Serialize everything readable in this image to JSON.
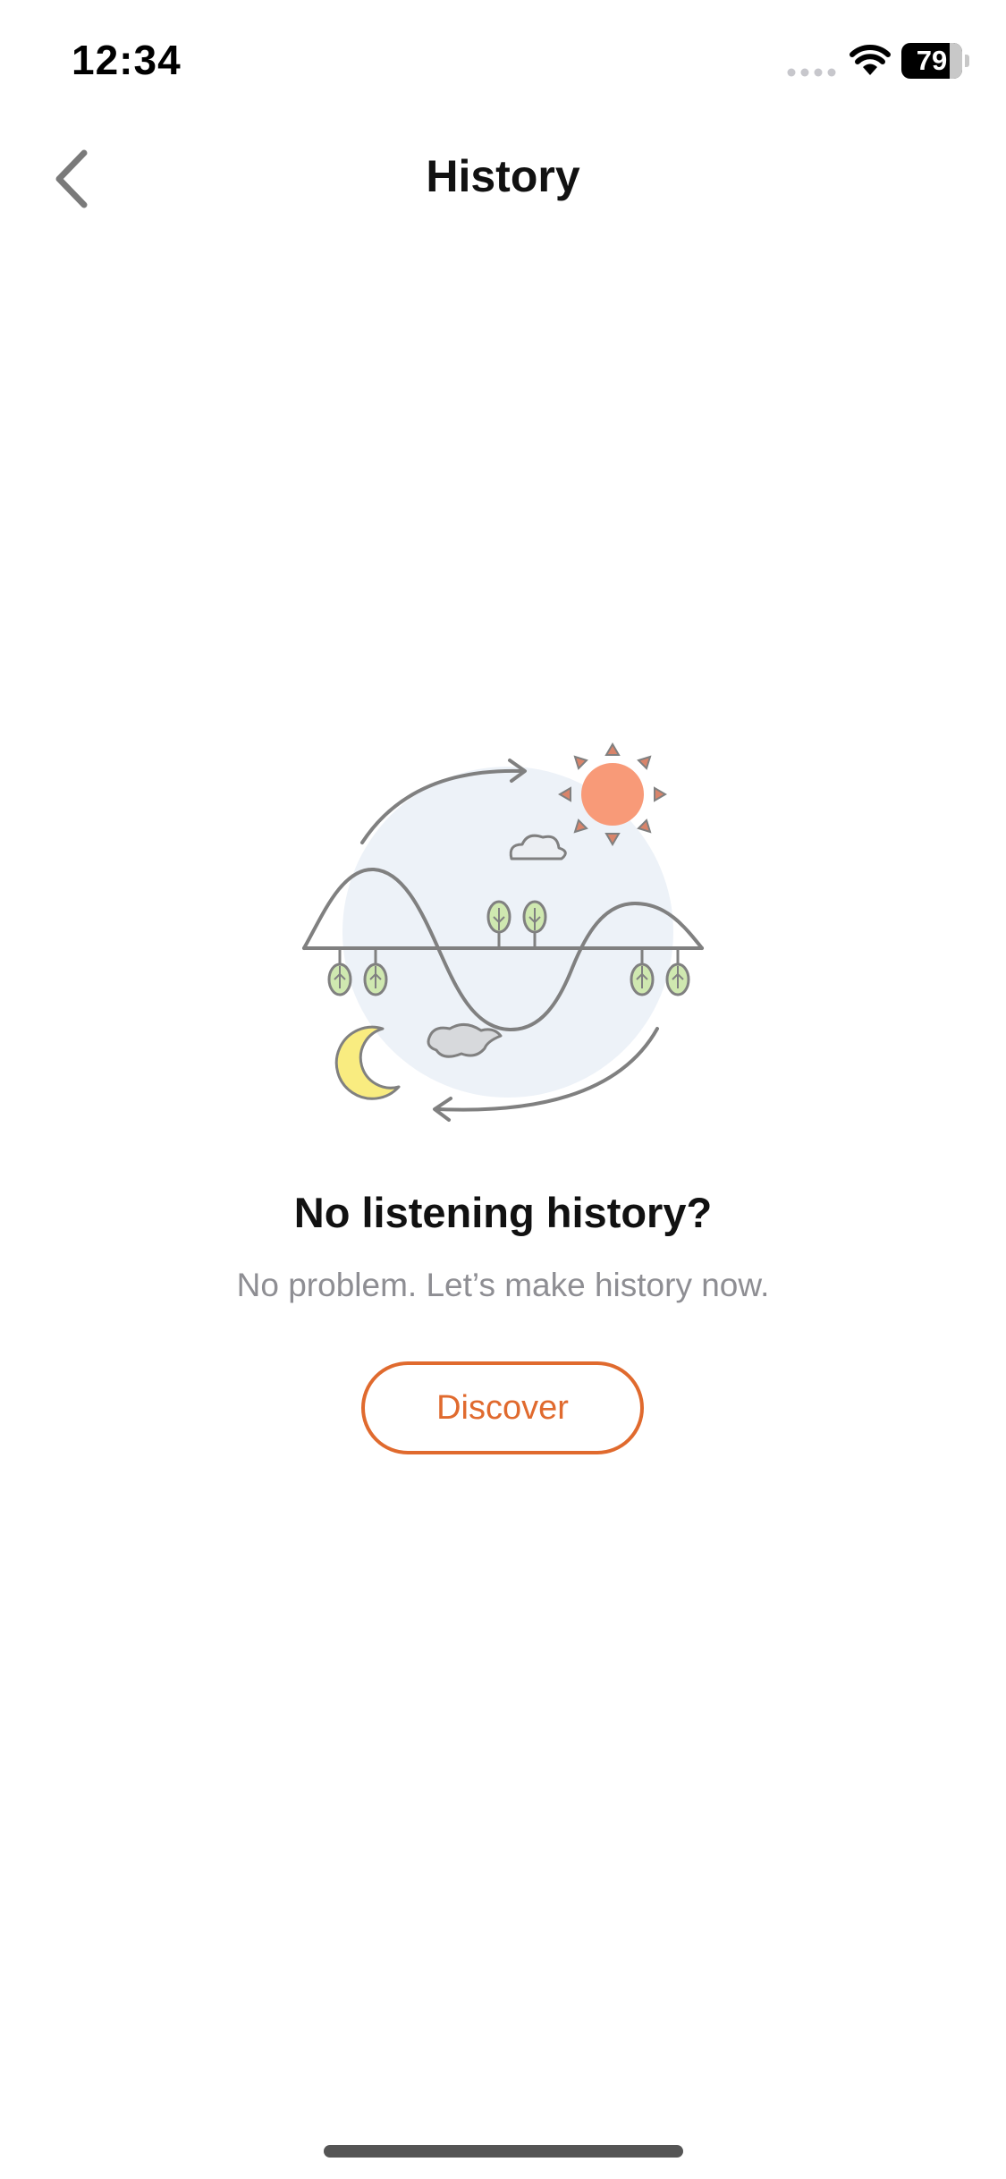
{
  "status_bar": {
    "time": "12:34",
    "battery_level": "79",
    "battery_percent": 79,
    "signal_icon": "cellular-signal-icon",
    "wifi_icon": "wifi-icon"
  },
  "nav": {
    "back_icon": "chevron-left-icon",
    "title": "History"
  },
  "empty_state": {
    "illustration": "day-night-cycle-illustration",
    "title": "No listening history?",
    "subtitle": "No problem. Let’s make history now.",
    "button_label": "Discover"
  },
  "colors": {
    "accent": "#e06a2e",
    "sun": "#f89a78",
    "moon": "#f9ec80",
    "tree": "#cfe8b0",
    "circle": "#edf2f8",
    "line": "#808080"
  }
}
